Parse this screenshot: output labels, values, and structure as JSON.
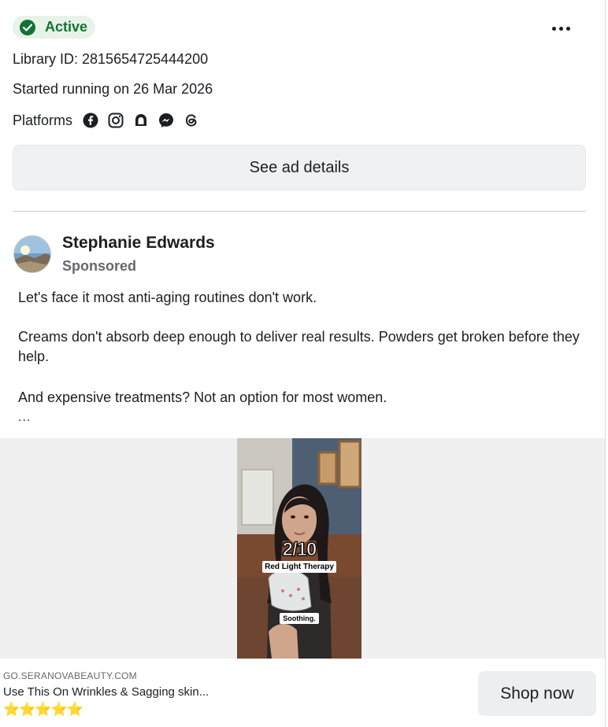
{
  "status": {
    "label": "Active",
    "color": "#137333"
  },
  "library": {
    "id_text": "Library ID: 2815654725444200"
  },
  "started": {
    "text": "Started running on 26 Mar 2026"
  },
  "platforms": {
    "label": "Platforms",
    "icons": [
      "facebook-icon",
      "instagram-icon",
      "audience-network-icon",
      "messenger-icon",
      "threads-icon"
    ]
  },
  "details_button": {
    "label": "See ad details"
  },
  "advertiser": {
    "name": "Stephanie Edwards",
    "sponsored_label": "Sponsored"
  },
  "ad_body": {
    "p1": "Let's face it most anti-aging routines don't work.",
    "p2": "Creams don't absorb deep enough to deliver real results. Powders get broken before they help.",
    "p3": "And expensive treatments? Not an option for most women.",
    "ellipsis": "..."
  },
  "video": {
    "counter": "2/10",
    "caption_top": "Red Light Therapy",
    "caption_bottom": "Soothing."
  },
  "link": {
    "domain": "GO.SERANOVABEAUTY.COM",
    "headline": "Use This On Wrinkles & Sagging skin...",
    "stars": "⭐⭐⭐⭐⭐"
  },
  "cta": {
    "label": "Shop now"
  }
}
